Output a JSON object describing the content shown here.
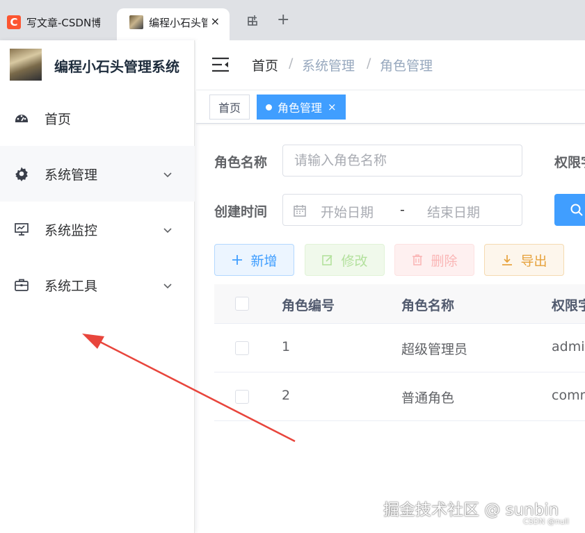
{
  "browser": {
    "tabs": [
      {
        "favicon_text": "C",
        "title": "写文章-CSDN博"
      },
      {
        "title": "编程小石头管",
        "close": "×"
      }
    ],
    "new_tab": "+"
  },
  "sidebar": {
    "brand": "编程小石头管理系统",
    "items": [
      {
        "label": "首页",
        "icon": "dashboard-icon"
      },
      {
        "label": "系统管理",
        "icon": "gear-icon",
        "expandable": true
      },
      {
        "label": "系统监控",
        "icon": "monitor-icon",
        "expandable": true
      },
      {
        "label": "系统工具",
        "icon": "toolbox-icon",
        "expandable": true
      }
    ]
  },
  "breadcrumb": {
    "home": "首页",
    "separator": "/",
    "level1": "系统管理",
    "level2": "角色管理"
  },
  "tags_view": {
    "tags": [
      {
        "label": "首页",
        "active": false
      },
      {
        "label": "角色管理",
        "active": true,
        "close": "×"
      }
    ]
  },
  "search_form": {
    "role_name_label": "角色名称",
    "role_name_placeholder": "请输入角色名称",
    "perm_label": "权限字",
    "created_label": "创建时间",
    "start_placeholder": "开始日期",
    "range_sep": "-",
    "end_placeholder": "结束日期"
  },
  "actions": {
    "add": "新增",
    "edit": "修改",
    "delete": "删除",
    "export": "导出"
  },
  "table": {
    "columns": [
      "角色编号",
      "角色名称",
      "权限字"
    ],
    "rows": [
      {
        "id": "1",
        "name": "超级管理员",
        "key": "admin"
      },
      {
        "id": "2",
        "name": "普通角色",
        "key": "common"
      }
    ]
  },
  "watermark": {
    "main": "掘金技术社区 @ sunbin",
    "sub": "CSDN @null"
  },
  "colors": {
    "primary": "#409eff",
    "annotation_arrow": "#e8453c"
  }
}
